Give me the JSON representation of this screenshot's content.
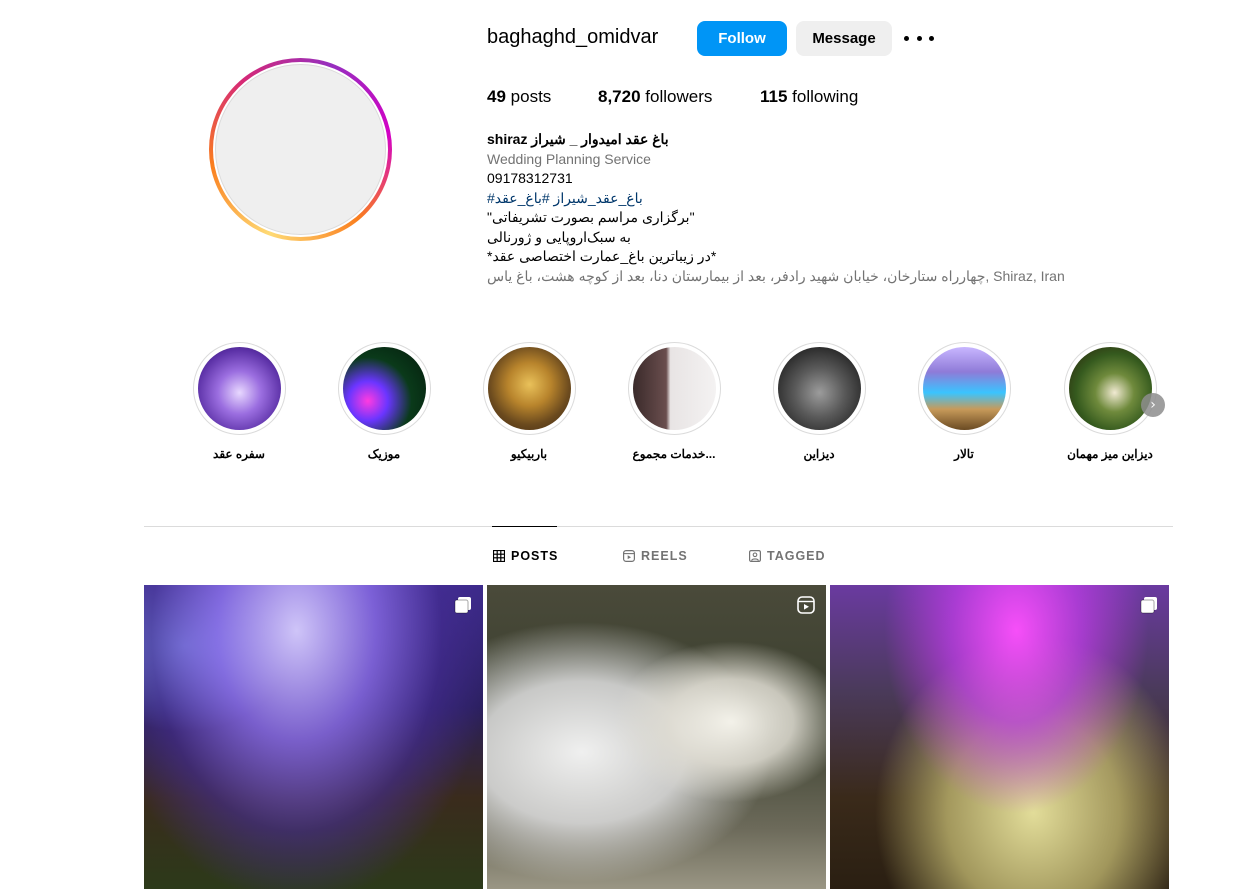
{
  "profile": {
    "username": "baghaghd_omidvar",
    "follow_label": "Follow",
    "message_label": "Message",
    "stats": {
      "posts_count": "49",
      "posts_label": "posts",
      "followers_count": "8,720",
      "followers_label": "followers",
      "following_count": "115",
      "following_label": "following"
    },
    "bio": {
      "name": "shiraz باغ عقد امیدوار _ شیراز",
      "category": "Wedding Planning Service",
      "phone": "09178312731",
      "hashtags": "#باغ_عقد_شیراز #باغ_عقد",
      "line1": "\"برگزاری مراسم بصورت تشریفاتی\"",
      "line2": "به سبک‌اروپایی و ژورنالی",
      "line3": "*در زیباترین باغ_عمارت اختصاصی عقد*",
      "location": "چهارراه ستارخان، خیابان شهید رادفر، بعد از بیمارستان دنا، بعد از کوچه هشت، باغ یاس, Shiraz, Iran"
    }
  },
  "highlights": [
    {
      "label": "سفره عقد"
    },
    {
      "label": "موزیک"
    },
    {
      "label": "باربیکیو"
    },
    {
      "label": "خدمات مجموع..."
    },
    {
      "label": "دیزاین"
    },
    {
      "label": "تالار"
    },
    {
      "label": "دیزاین میز مهمان"
    }
  ],
  "tabs": {
    "posts": "POSTS",
    "reels": "REELS",
    "tagged": "TAGGED"
  },
  "posts": [
    {
      "type": "carousel"
    },
    {
      "type": "reel"
    },
    {
      "type": "carousel"
    }
  ],
  "icons": {
    "more": "more-horizontal-icon",
    "posts_tab": "grid-icon",
    "reels_tab": "reels-icon",
    "tagged_tab": "tagged-icon",
    "next": "chevron-right-icon",
    "carousel": "carousel-icon",
    "reel": "reel-icon"
  },
  "colors": {
    "follow_bg": "#0095f6",
    "message_bg": "#efefef",
    "link": "#00376b",
    "muted": "#737373"
  }
}
